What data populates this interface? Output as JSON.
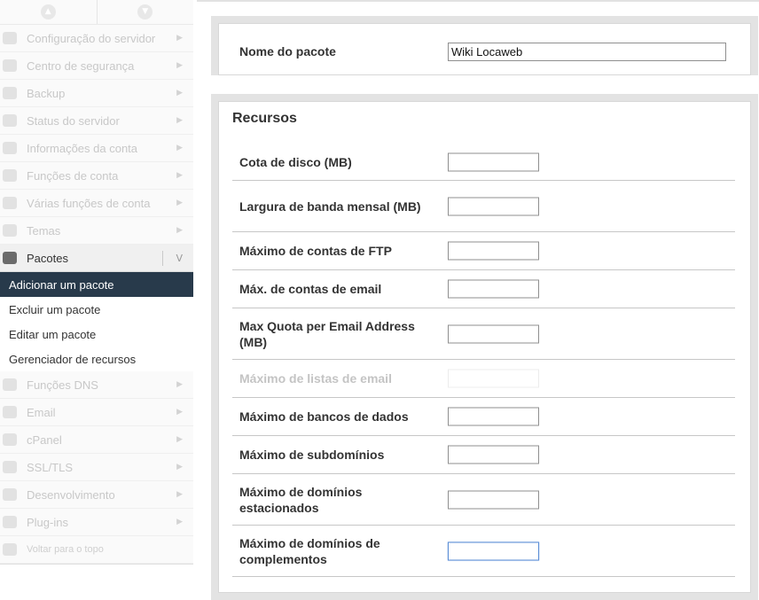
{
  "sidebar": {
    "nav_top": [
      "Configuração do servidor",
      "Centro de segurança",
      "Backup",
      "Status do servidor",
      "Informações da conta",
      "Funções de conta",
      "Várias funções de conta",
      "Temas"
    ],
    "open_section": "Pacotes",
    "sub_items": [
      "Adicionar um pacote",
      "Excluir um pacote",
      "Editar um pacote",
      "Gerenciador de recursos"
    ],
    "nav_bottom": [
      "Funções DNS",
      "Email",
      "cPanel",
      "SSL/TLS",
      "Desenvolvimento",
      "Plug-ins"
    ],
    "back_to_top": "Voltar para o topo",
    "arrow_glyph": "▶",
    "open_arrow_glyph": "V",
    "up_glyph": "▲",
    "down_glyph": "▼"
  },
  "package": {
    "label": "Nome do pacote",
    "value": "Wiki Locaweb"
  },
  "resources": {
    "title": "Recursos",
    "fields": [
      "Cota de disco (MB)",
      "Largura de banda mensal (MB)",
      "Máximo de contas de FTP",
      "Máx. de contas de email",
      "Max Quota per Email Address (MB)",
      "Máximo de listas de email",
      "Máximo de bancos de dados",
      "Máximo de subdomínios",
      "Máximo de domínios estacionados",
      "Máximo de domínios de complementos"
    ]
  },
  "colors": {
    "active_sub_bg": "#283a4b",
    "focus_border": "#5b8ed6"
  }
}
